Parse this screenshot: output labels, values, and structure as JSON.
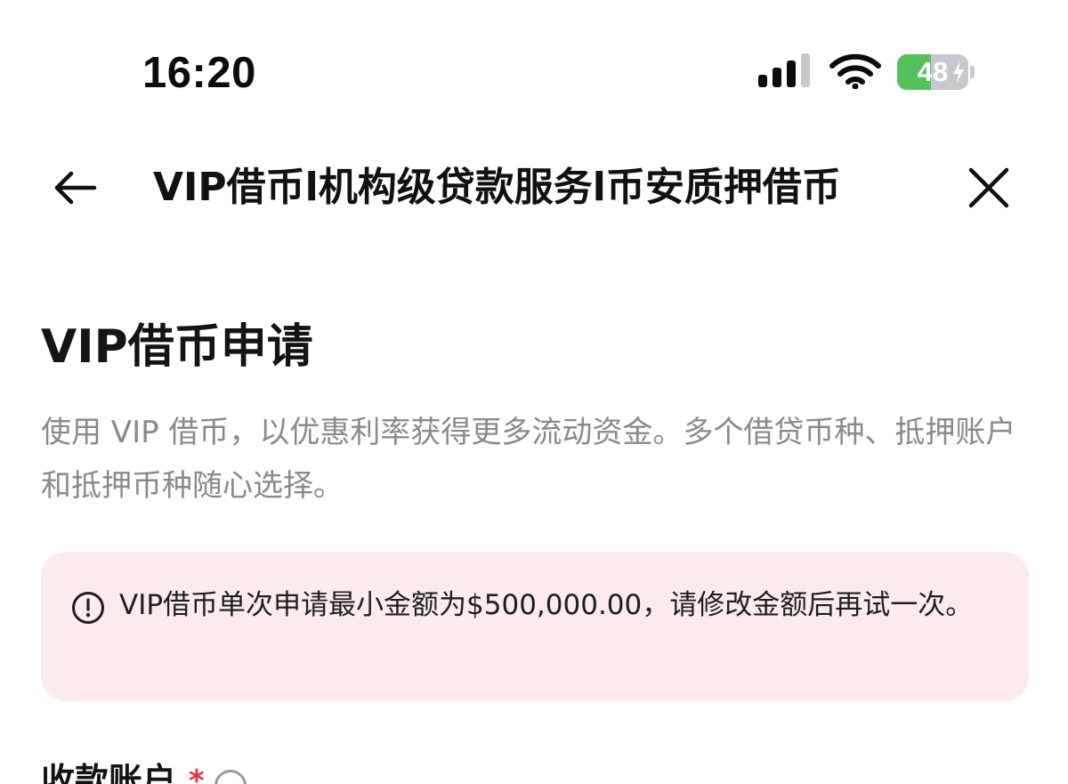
{
  "status_bar": {
    "time": "16:20",
    "signal_icon": "cellular-signal-icon",
    "wifi_icon": "wifi-icon",
    "battery_level": "48",
    "battery_fraction": 0.48,
    "battery_charging": true,
    "battery_color": "#53c25a"
  },
  "nav": {
    "back_icon": "arrow-left-icon",
    "title": "VIP借币l机构级贷款服务l币安质押借币",
    "close_icon": "close-icon"
  },
  "main": {
    "title": "VIP借币申请",
    "description": "使用 VIP 借币，以优惠利率获得更多流动资金。多个借贷币种、抵押账户和抵押币种随心选择。",
    "alert": {
      "icon": "exclamation-circle-icon",
      "text": "VIP借币单次申请最小金额为$500,000.00，请修改金额后再试一次。",
      "background": "#fbebec"
    },
    "field": {
      "label": "收款账户",
      "required_mark": "*",
      "required_color": "#e3354a",
      "info_icon": "question-circle-icon"
    }
  }
}
